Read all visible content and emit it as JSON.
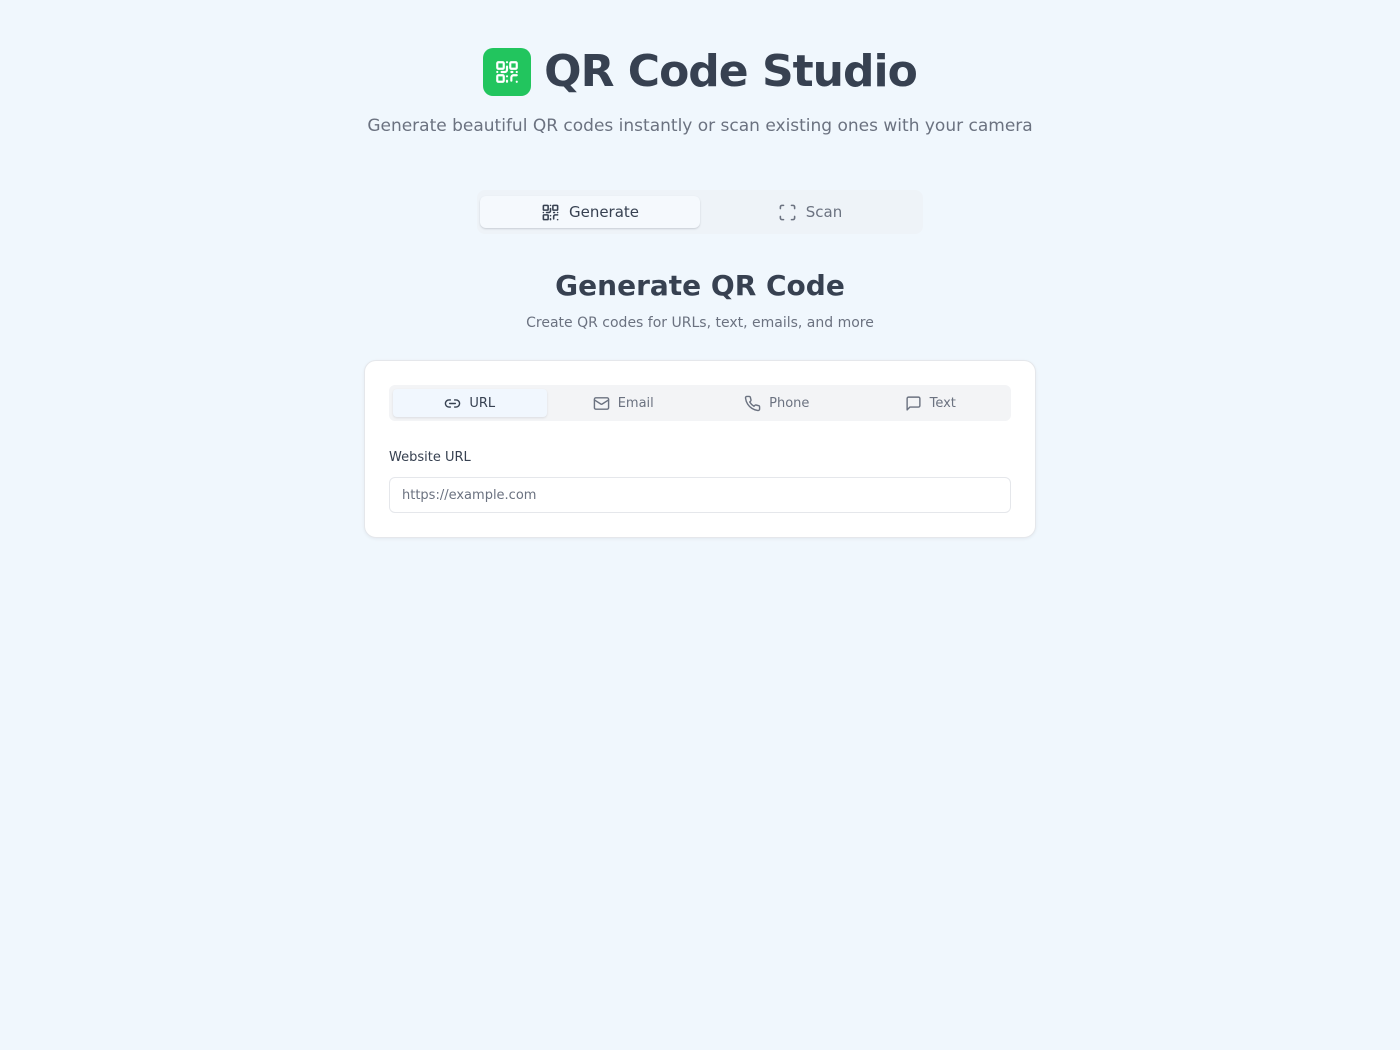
{
  "header": {
    "title": "QR Code Studio",
    "subtitle": "Generate beautiful QR codes instantly or scan existing ones with your camera",
    "logo_icon": "qr-code-icon",
    "brand_color": "#22c55e"
  },
  "mode_tabs": [
    {
      "label": "Generate",
      "icon": "qr-code-icon",
      "active": true
    },
    {
      "label": "Scan",
      "icon": "scan-frame-icon",
      "active": false
    }
  ],
  "section": {
    "title": "Generate QR Code",
    "subtitle": "Create QR codes for URLs, text, emails, and more"
  },
  "type_tabs": [
    {
      "label": "URL",
      "icon": "link-icon",
      "active": true
    },
    {
      "label": "Email",
      "icon": "mail-icon",
      "active": false
    },
    {
      "label": "Phone",
      "icon": "phone-icon",
      "active": false
    },
    {
      "label": "Text",
      "icon": "message-icon",
      "active": false
    }
  ],
  "url_field": {
    "label": "Website URL",
    "placeholder": "https://example.com",
    "value": ""
  }
}
